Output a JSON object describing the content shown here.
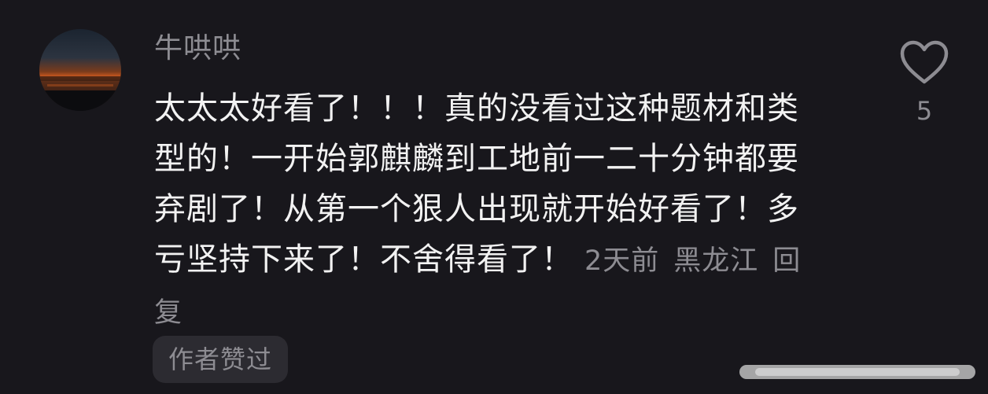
{
  "comment": {
    "username": "牛哄哄",
    "text": "太太太好看了！！！真的没看过这种题材和类型的！一开始郭麒麟到工地前一二十分钟都要弃剧了！从第一个狠人出现就开始好看了！多亏坚持下来了！不舍得看了！",
    "time": "2天前",
    "location": "黑龙江",
    "reply_label": "回复",
    "author_badge": "作者赞过",
    "like_count": "5",
    "avatar_icon": "sunset-avatar",
    "like_icon": "heart-icon"
  },
  "colors": {
    "background": "#18171c",
    "text_primary": "#f2f2f2",
    "text_secondary": "#8d8c92",
    "badge_bg": "#2c2b31"
  }
}
